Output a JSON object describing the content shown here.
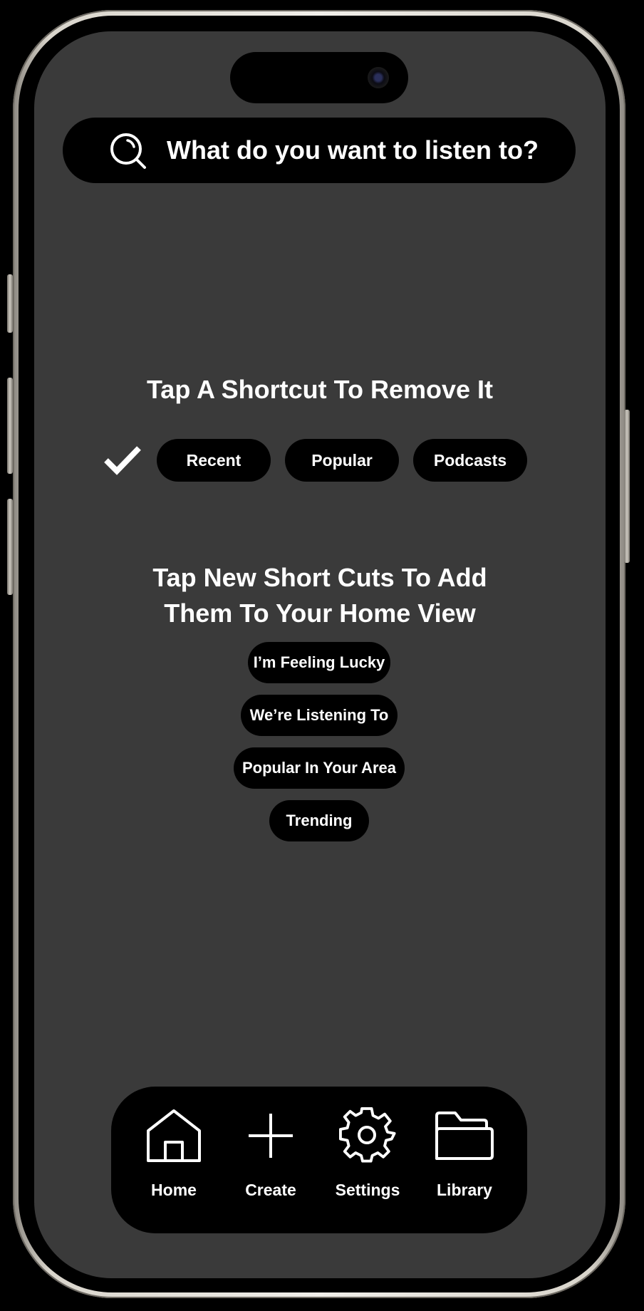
{
  "search": {
    "placeholder": "What do you want to listen to?",
    "icon": "search-icon"
  },
  "remove_section": {
    "heading": "Tap A Shortcut To Remove It",
    "check_icon": "checkmark-icon",
    "shortcuts": [
      "Recent",
      "Popular",
      "Podcasts"
    ]
  },
  "add_section": {
    "heading_line1": "Tap New Short Cuts To Add",
    "heading_line2": "Them To Your Home View",
    "shortcuts": [
      "I’m Feeling Lucky",
      "We’re Listening To",
      "Popular In Your Area",
      "Trending"
    ]
  },
  "nav": [
    {
      "label": "Home",
      "icon": "home-icon"
    },
    {
      "label": "Create",
      "icon": "plus-icon"
    },
    {
      "label": "Settings",
      "icon": "gear-icon"
    },
    {
      "label": "Library",
      "icon": "folder-icon"
    }
  ],
  "colors": {
    "screen_bg": "#3a3a3a",
    "pill_bg": "#000000",
    "text": "#ffffff"
  }
}
